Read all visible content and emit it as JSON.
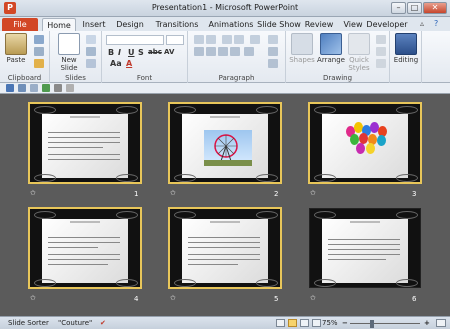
{
  "window": {
    "title": "Presentation1 - Microsoft PowerPoint",
    "app_letter": "P"
  },
  "tabs": [
    "File",
    "Home",
    "Insert",
    "Design",
    "Transitions",
    "Animations",
    "Slide Show",
    "Review",
    "View",
    "Developer"
  ],
  "ribbon": {
    "clipboard": {
      "label": "Clipboard",
      "paste": "Paste"
    },
    "slides": {
      "label": "Slides",
      "new_slide_line1": "New",
      "new_slide_line2": "Slide"
    },
    "font": {
      "label": "Font",
      "buttons": [
        "B",
        "I",
        "U",
        "S",
        "abc",
        "AV",
        "Aa",
        "A"
      ]
    },
    "paragraph": {
      "label": "Paragraph"
    },
    "drawing": {
      "label": "Drawing",
      "shapes": "Shapes",
      "arrange": "Arrange",
      "quick_styles_1": "Quick",
      "quick_styles_2": "Styles"
    },
    "editing": {
      "label": "Editing"
    }
  },
  "slides": [
    {
      "number": "1",
      "picture": "none",
      "selected": true
    },
    {
      "number": "2",
      "picture": "ferris-wheel",
      "selected": true
    },
    {
      "number": "3",
      "picture": "balloons",
      "selected": true
    },
    {
      "number": "4",
      "picture": "none",
      "selected": true
    },
    {
      "number": "5",
      "picture": "none",
      "selected": true
    },
    {
      "number": "6",
      "picture": "none",
      "selected": false
    }
  ],
  "status": {
    "view": "Slide Sorter",
    "theme": "\"Couture\"",
    "zoom": "75%"
  },
  "colors": {
    "file_tab": "#d24726",
    "selection": "#e8c65a",
    "background": "#5b5b5b"
  }
}
